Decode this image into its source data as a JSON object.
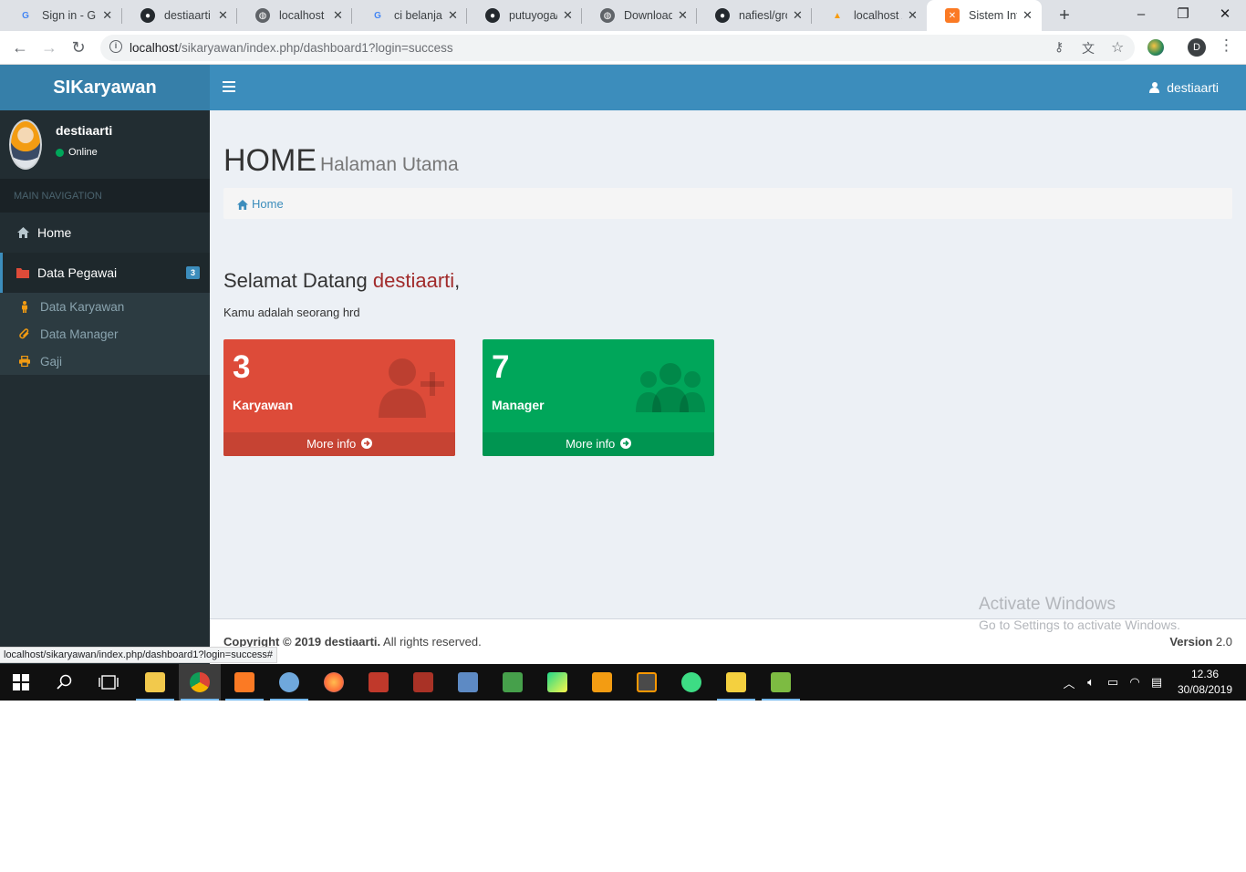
{
  "browser": {
    "tabs": [
      {
        "title": "Sign in - Gc",
        "icon": "google-icon",
        "color": "#4285f4",
        "glyph": "G"
      },
      {
        "title": "destiaarti (c",
        "icon": "github-icon",
        "color": "#24292e",
        "glyph": "●"
      },
      {
        "title": "localhost",
        "icon": "globe-icon",
        "color": "#5f6368",
        "glyph": "◍"
      },
      {
        "title": "ci belanja g",
        "icon": "google-icon",
        "color": "#4285f4",
        "glyph": "G"
      },
      {
        "title": "putuyoga/c",
        "icon": "github-icon",
        "color": "#24292e",
        "glyph": "●"
      },
      {
        "title": "Download S",
        "icon": "globe-icon",
        "color": "#5f6368",
        "glyph": "◍"
      },
      {
        "title": "nafiesl/gros",
        "icon": "github-icon",
        "color": "#24292e",
        "glyph": "●"
      },
      {
        "title": "localhost / ",
        "icon": "phpmyadmin-icon",
        "color": "#f89c0e",
        "glyph": "▲"
      },
      {
        "title": "Sistem Infor",
        "icon": "xampp-icon",
        "color": "#fb7a24",
        "glyph": "✕"
      }
    ],
    "url_host": "localhost",
    "url_path": "/sikaryawan/index.php/dashboard1?login=success",
    "profile_initial": "D",
    "status_url": "localhost/sikaryawan/index.php/dashboard1?login=success#"
  },
  "app": {
    "brand": "SIKaryawan",
    "header_user": "destiaarti",
    "sidebar": {
      "user_name": "destiaarti",
      "user_status": "Online",
      "nav_header": "MAIN NAVIGATION",
      "home_label": "Home",
      "data_pegawai_label": "Data Pegawai",
      "data_pegawai_badge": "3",
      "sub_items": [
        "Data Karyawan",
        "Data Manager",
        "Gaji"
      ]
    },
    "page": {
      "title": "HOME",
      "subtitle": "Halaman Utama",
      "breadcrumb": "Home",
      "welcome_prefix": "Selamat Datang ",
      "welcome_user": "destiaarti",
      "welcome_suffix": ",",
      "role_line": "Kamu adalah seorang hrd"
    },
    "boxes": {
      "karyawan": {
        "count": "3",
        "label": "Karyawan",
        "more": "More info ",
        "color": "#dd4b39"
      },
      "manager": {
        "count": "7",
        "label": "Manager",
        "more": "More info ",
        "color": "#00a65a"
      }
    },
    "footer": {
      "copyright_bold": "Copyright © 2019 destiaarti.",
      "copyright_rest": " All rights reserved.",
      "version_bold": "Version",
      "version_num": " 2.0"
    }
  },
  "watermark": {
    "line1": "Activate Windows",
    "line2": "Go to Settings to activate Windows."
  },
  "taskbar": {
    "time": "12.36",
    "date": "30/08/2019",
    "apps": [
      {
        "name": "file-explorer",
        "color": "#f2c94c"
      },
      {
        "name": "chrome",
        "color": "#4285f4"
      },
      {
        "name": "xampp",
        "color": "#fb7a24"
      },
      {
        "name": "paint",
        "color": "#6fa8dc"
      },
      {
        "name": "firefox",
        "color": "#ff7139"
      },
      {
        "name": "app-red-1",
        "color": "#c0392b"
      },
      {
        "name": "app-red-2",
        "color": "#a93226"
      },
      {
        "name": "remote-desktop",
        "color": "#5d8ac4"
      },
      {
        "name": "cmd-green",
        "color": "#46a04b"
      },
      {
        "name": "pycharm",
        "color": "#21d789"
      },
      {
        "name": "pdf-app",
        "color": "#f39c12"
      },
      {
        "name": "sublime-text",
        "color": "#4a4a4a"
      },
      {
        "name": "android-studio",
        "color": "#3ddc84"
      },
      {
        "name": "folder-sync",
        "color": "#f4d03f"
      },
      {
        "name": "notepad-app",
        "color": "#7dbb42"
      }
    ]
  }
}
